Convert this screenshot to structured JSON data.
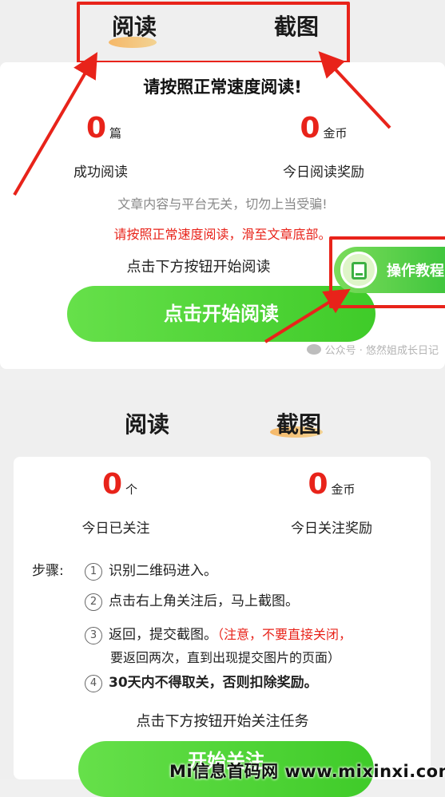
{
  "colors": {
    "accent_red": "#e8231a",
    "button_green": "#4fd636",
    "tab_highlight": "#f6b25a"
  },
  "panel_read": {
    "tabs": [
      {
        "label": "阅读",
        "active": true
      },
      {
        "label": "截图",
        "active": false
      }
    ],
    "heading": "请按照正常速度阅读!",
    "stats": [
      {
        "value": "0",
        "unit": "篇",
        "label": "成功阅读"
      },
      {
        "value": "0",
        "unit": "金币",
        "label": "今日阅读奖励"
      }
    ],
    "notice_gray": "文章内容与平台无关，切勿上当受骗!",
    "notice_red": "请按照正常速度阅读，滑至文章底部。",
    "instruction": "点击下方按钮开始阅读",
    "start_button": "点击开始阅读",
    "tutorial_button": {
      "label": "操作教程",
      "icon": "book-icon"
    },
    "watermark": "公众号 · 悠然姐成长日记"
  },
  "panel_screenshot": {
    "tabs": [
      {
        "label": "阅读",
        "active": false
      },
      {
        "label": "截图",
        "active": true
      }
    ],
    "stats": [
      {
        "value": "0",
        "unit": "个",
        "label": "今日已关注"
      },
      {
        "value": "0",
        "unit": "金币",
        "label": "今日关注奖励"
      }
    ],
    "steps_label": "步骤:",
    "steps": [
      {
        "num": "1",
        "text": "识别二维码进入。"
      },
      {
        "num": "2",
        "text": "点击右上角关注后，马上截图。"
      },
      {
        "num": "3",
        "text": "返回，提交截图。",
        "note": "（注意，不要直接关闭，",
        "note2": "要返回两次，直到出现提交图片的页面）"
      },
      {
        "num": "4",
        "text": "30天内不得取关，否则扣除奖励。"
      }
    ],
    "instruction": "点击下方按钮开始关注任务",
    "start_button": "开始关注"
  },
  "footer_watermark": "Mi信息首码网 www.mixinxi.com"
}
